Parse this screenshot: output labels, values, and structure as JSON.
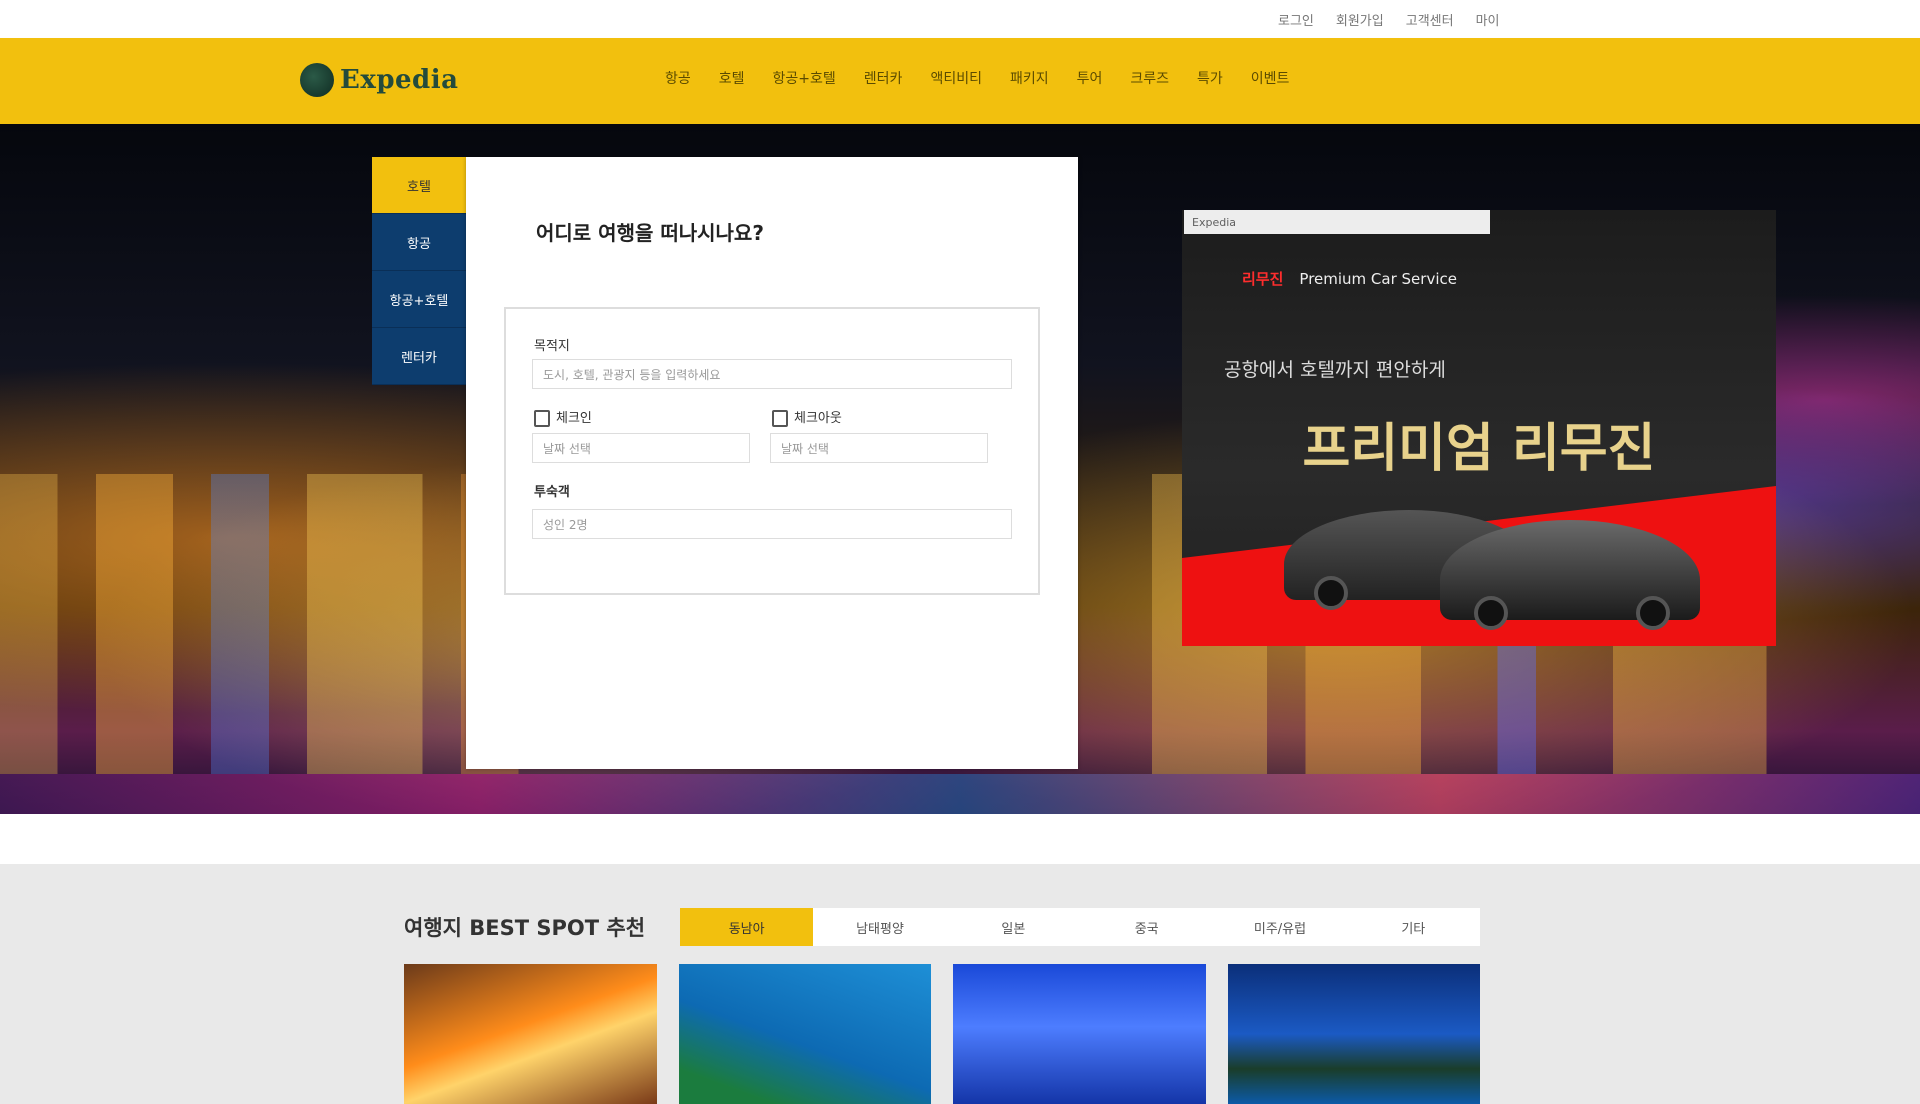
{
  "top_links": [
    "로그인",
    "회원가입",
    "고객센터",
    "마이"
  ],
  "brand": {
    "name": "Expedia",
    "nav_color": "#f2c00e",
    "tab_color": "#0d3d6e"
  },
  "nav_menu": [
    "항공",
    "호텔",
    "항공+호텔",
    "렌터카",
    "액티비티",
    "패키지",
    "투어",
    "크루즈",
    "특가",
    "이벤트"
  ],
  "search_tabs": [
    "호텔",
    "항공",
    "항공+호텔",
    "렌터카"
  ],
  "search": {
    "heading": "어디로 여행을 떠나시나요?",
    "destination_label": "목적지",
    "destination_placeholder": "도시, 호텔, 관광지 등을 입력하세요",
    "checkin_label": "체크인",
    "checkin_placeholder": "날짜 선택",
    "checkout_label": "체크아웃",
    "checkout_placeholder": "날짜 선택",
    "guests_label": "투숙객",
    "guests_value": "성인 2명"
  },
  "ad": {
    "top_bar": "Expedia",
    "tag": "리무진",
    "tagline": "Premium Car Service",
    "subline": "공항에서 호텔까지 편안하게",
    "headline": "프리미엄 리무진"
  },
  "spots": {
    "title": "여행지 BEST SPOT 추천",
    "tabs": [
      "동남아",
      "남태평양",
      "일본",
      "중국",
      "미주/유럽",
      "기타"
    ]
  }
}
